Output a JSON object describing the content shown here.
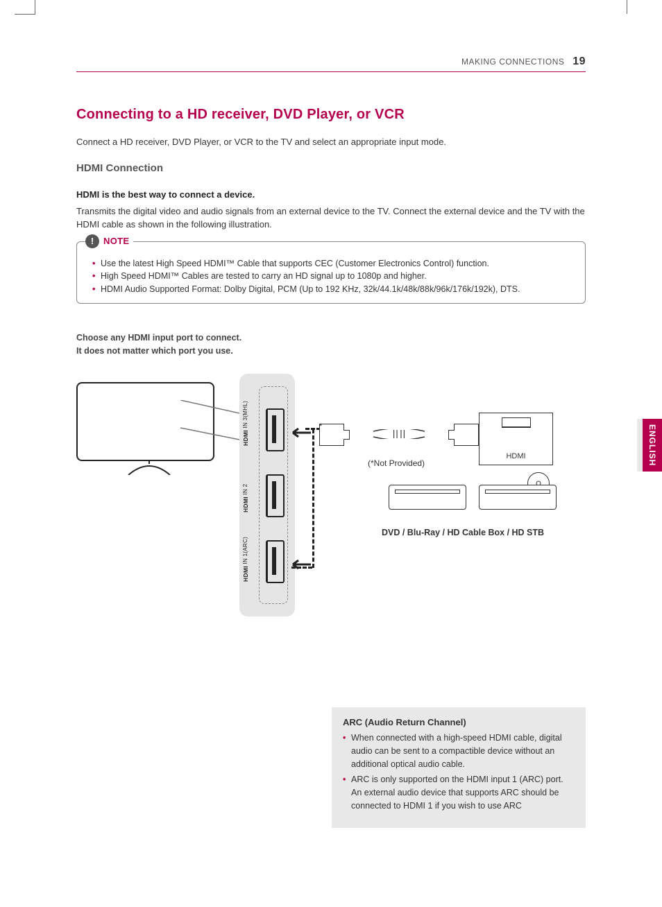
{
  "header": {
    "section": "MAKING CONNECTIONS",
    "page": "19"
  },
  "title": "Connecting to a HD receiver, DVD Player, or VCR",
  "intro": "Connect a HD receiver, DVD Player, or VCR to the TV and select an appropriate input mode.",
  "sub": "HDMI Connection",
  "bold": "HDMI is the best way to connect a device.",
  "body": "Transmits the digital video and audio signals from an external device to the TV. Connect the external device and the TV with the HDMI cable as shown in the following illustration.",
  "note_label": "NOTE",
  "notes": [
    "Use the latest High Speed HDMI™ Cable that supports CEC (Customer Electronics Control) function.",
    "High Speed HDMI™ Cables are tested to carry an HD signal up to 1080p and higher.",
    "HDMI Audio Supported Format: Dolby Digital, PCM (Up to 192 KHz, 32k/44.1k/48k/88k/96k/176k/192k), DTS."
  ],
  "choose": {
    "l1": "Choose any HDMI input port to connect.",
    "l2": "It does not matter which port you use."
  },
  "ports": {
    "p1": "HDMI IN 1(ARC)",
    "p2": "HDMI IN 2",
    "p3": "HDMI IN 3(MHL)"
  },
  "diagram": {
    "not_provided": "(*Not Provided)",
    "device_port": "HDMI",
    "devices_caption": "DVD / Blu-Ray / HD Cable Box / HD STB",
    "asterisk": "*"
  },
  "arc": {
    "heading": "ARC (Audio Return Channel)",
    "items": [
      "When connected with a high-speed HDMI cable, digital audio can be sent to a compactible device without an additional optical audio cable.",
      "ARC is only supported on the HDMI input 1 (ARC) port. An external audio device that supports ARC should be connected to HDMI 1 if you wish to use ARC"
    ]
  },
  "lang": "ENGLISH"
}
